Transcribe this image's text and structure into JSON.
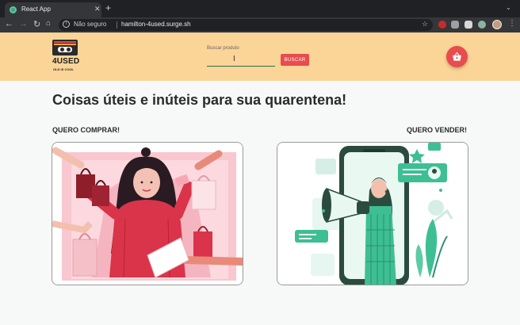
{
  "browser": {
    "tab_title": "React App",
    "tab_close": "✕",
    "new_tab": "+",
    "address_security": "Não seguro",
    "url": "hamilton-4used.surge.sh"
  },
  "header": {
    "brand": "4USED",
    "tagline": "OLD IS COOL",
    "search_label": "Buscar produto",
    "search_value": "",
    "search_button": "BUSCAR"
  },
  "main": {
    "headline": "Coisas úteis e inúteis para sua quarentena!",
    "buy_label": "QUERO COMPRAR!",
    "sell_label": "QUERO VENDER!"
  },
  "colors": {
    "header_bg": "#fbd597",
    "accent_red": "#e84c4c",
    "accent_green": "#2f6b4a",
    "illustration_pink": "#f26b7e",
    "illustration_teal": "#3dbf93"
  },
  "icons": {
    "cart": "shopping-basket-icon",
    "favicon": "react-favicon-icon"
  }
}
